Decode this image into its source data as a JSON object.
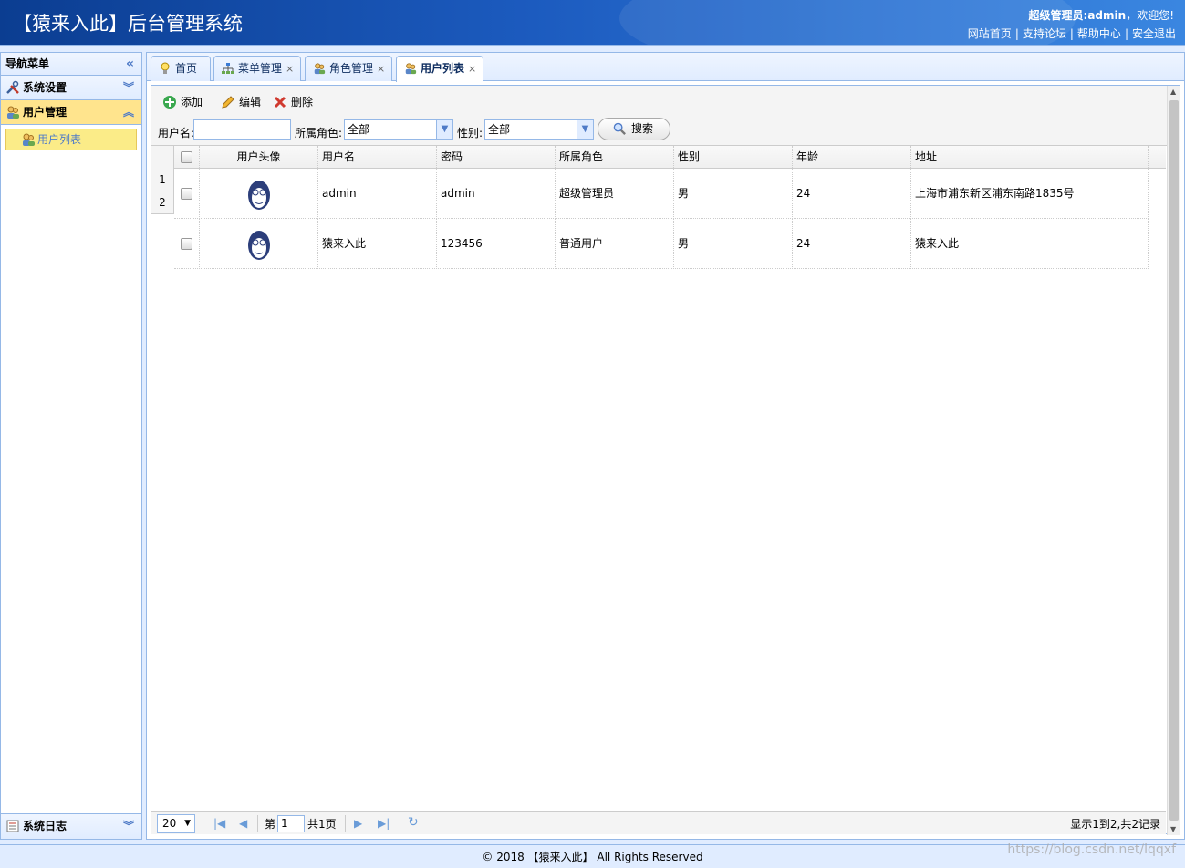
{
  "header": {
    "title": "【猿来入此】后台管理系统",
    "welcome_role": "超级管理员:admin",
    "welcome_suffix": "，欢迎您!",
    "links": [
      "网站首页",
      "支持论坛",
      "帮助中心",
      "安全退出"
    ]
  },
  "nav": {
    "title": "导航菜单",
    "groups": [
      {
        "label": "系统设置",
        "icon": "tools-icon"
      },
      {
        "label": "用户管理",
        "icon": "users-icon",
        "items": [
          "用户列表"
        ]
      },
      {
        "label": "系统日志",
        "icon": "log-icon"
      }
    ]
  },
  "tabs": [
    {
      "label": "首页",
      "icon": "bulb-icon",
      "closable": false
    },
    {
      "label": "菜单管理",
      "icon": "sitemap-icon",
      "closable": true
    },
    {
      "label": "角色管理",
      "icon": "users-icon",
      "closable": true
    },
    {
      "label": "用户列表",
      "icon": "users-icon",
      "closable": true,
      "active": true
    }
  ],
  "toolbar": {
    "add": "添加",
    "edit": "编辑",
    "delete": "删除"
  },
  "search": {
    "username_label": "用户名:",
    "username_value": "",
    "role_label": "所属角色:",
    "role_value": "全部",
    "sex_label": "性别:",
    "sex_value": "全部",
    "search_btn": "搜索"
  },
  "grid": {
    "columns": [
      "用户头像",
      "用户名",
      "密码",
      "所属角色",
      "性别",
      "年龄",
      "地址"
    ],
    "rows": [
      {
        "num": "1",
        "username": "admin",
        "password": "admin",
        "role": "超级管理员",
        "sex": "男",
        "age": "24",
        "address": "上海市浦东新区浦东南路1835号"
      },
      {
        "num": "2",
        "username": "猿来入此",
        "password": "123456",
        "role": "普通用户",
        "sex": "男",
        "age": "24",
        "address": "猿来入此"
      }
    ]
  },
  "pager": {
    "page_size": "20",
    "page_prefix": "第",
    "page_value": "1",
    "page_total": "共1页",
    "summary": "显示1到2,共2记录"
  },
  "footer": "© 2018 【猿来入此】 All Rights Reserved",
  "watermark": "https://blog.csdn.net/lqqxf"
}
